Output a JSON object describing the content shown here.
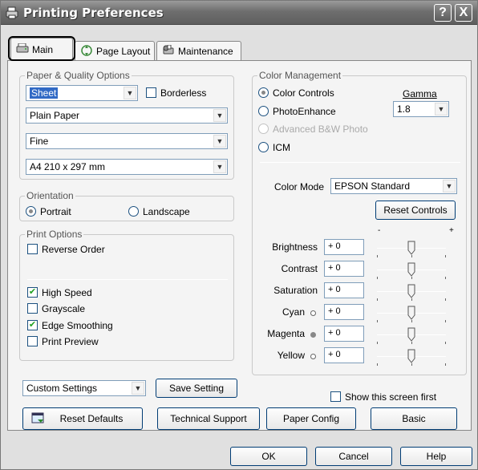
{
  "window": {
    "title": "Printing Preferences",
    "help_button": "?",
    "close_button": "X",
    "title_icon": "printer-icon"
  },
  "tabs": [
    {
      "label": "Main",
      "icon": "printer-icon",
      "active": true
    },
    {
      "label": "Page Layout",
      "icon": "page-layout-icon",
      "active": false
    },
    {
      "label": "Maintenance",
      "icon": "maintenance-icon",
      "active": false
    }
  ],
  "paper_quality": {
    "legend": "Paper & Quality Options",
    "source_value": "Sheet",
    "borderless_label": "Borderless",
    "borderless_checked": false,
    "media_value": "Plain Paper",
    "quality_value": "Fine",
    "size_value": "A4 210 x 297 mm"
  },
  "orientation": {
    "legend": "Orientation",
    "portrait_label": "Portrait",
    "landscape_label": "Landscape",
    "selected": "Portrait"
  },
  "print_options": {
    "legend": "Print Options",
    "reverse_order": {
      "label": "Reverse Order",
      "checked": false
    },
    "high_speed": {
      "label": "High Speed",
      "checked": true
    },
    "grayscale": {
      "label": "Grayscale",
      "checked": false
    },
    "edge_smoothing": {
      "label": "Edge Smoothing",
      "checked": true
    },
    "print_preview": {
      "label": "Print Preview",
      "checked": false
    }
  },
  "settings": {
    "custom_value": "Custom Settings",
    "save_setting_label": "Save Setting",
    "reset_defaults_label": "Reset Defaults",
    "technical_support_label": "Technical Support"
  },
  "color_management": {
    "legend": "Color Management",
    "color_controls_label": "Color Controls",
    "photoenhance_label": "PhotoEnhance",
    "advanced_bw_label": "Advanced B&W Photo",
    "icm_label": "ICM",
    "selected": "Color Controls",
    "gamma_label": "Gamma",
    "gamma_value": "1.8",
    "color_mode_label": "Color Mode",
    "color_mode_value": "EPSON Standard",
    "reset_controls_label": "Reset Controls",
    "slider_minus": "-",
    "slider_plus": "+",
    "controls": [
      {
        "label": "Brightness",
        "value": "+ 0",
        "position": 0.5,
        "dot": null
      },
      {
        "label": "Contrast",
        "value": "+ 0",
        "position": 0.5,
        "dot": null
      },
      {
        "label": "Saturation",
        "value": "+ 0",
        "position": 0.5,
        "dot": null
      },
      {
        "label": "Cyan",
        "value": "+ 0",
        "position": 0.5,
        "dot": "hollow"
      },
      {
        "label": "Magenta",
        "value": "+ 0",
        "position": 0.5,
        "dot": "filled"
      },
      {
        "label": "Yellow",
        "value": "+ 0",
        "position": 0.5,
        "dot": "hollow"
      }
    ],
    "show_first_label": "Show this screen first",
    "show_first_checked": false,
    "paper_config_label": "Paper Config",
    "basic_label": "Basic"
  },
  "footer": {
    "ok_label": "OK",
    "cancel_label": "Cancel",
    "help_label": "Help"
  }
}
